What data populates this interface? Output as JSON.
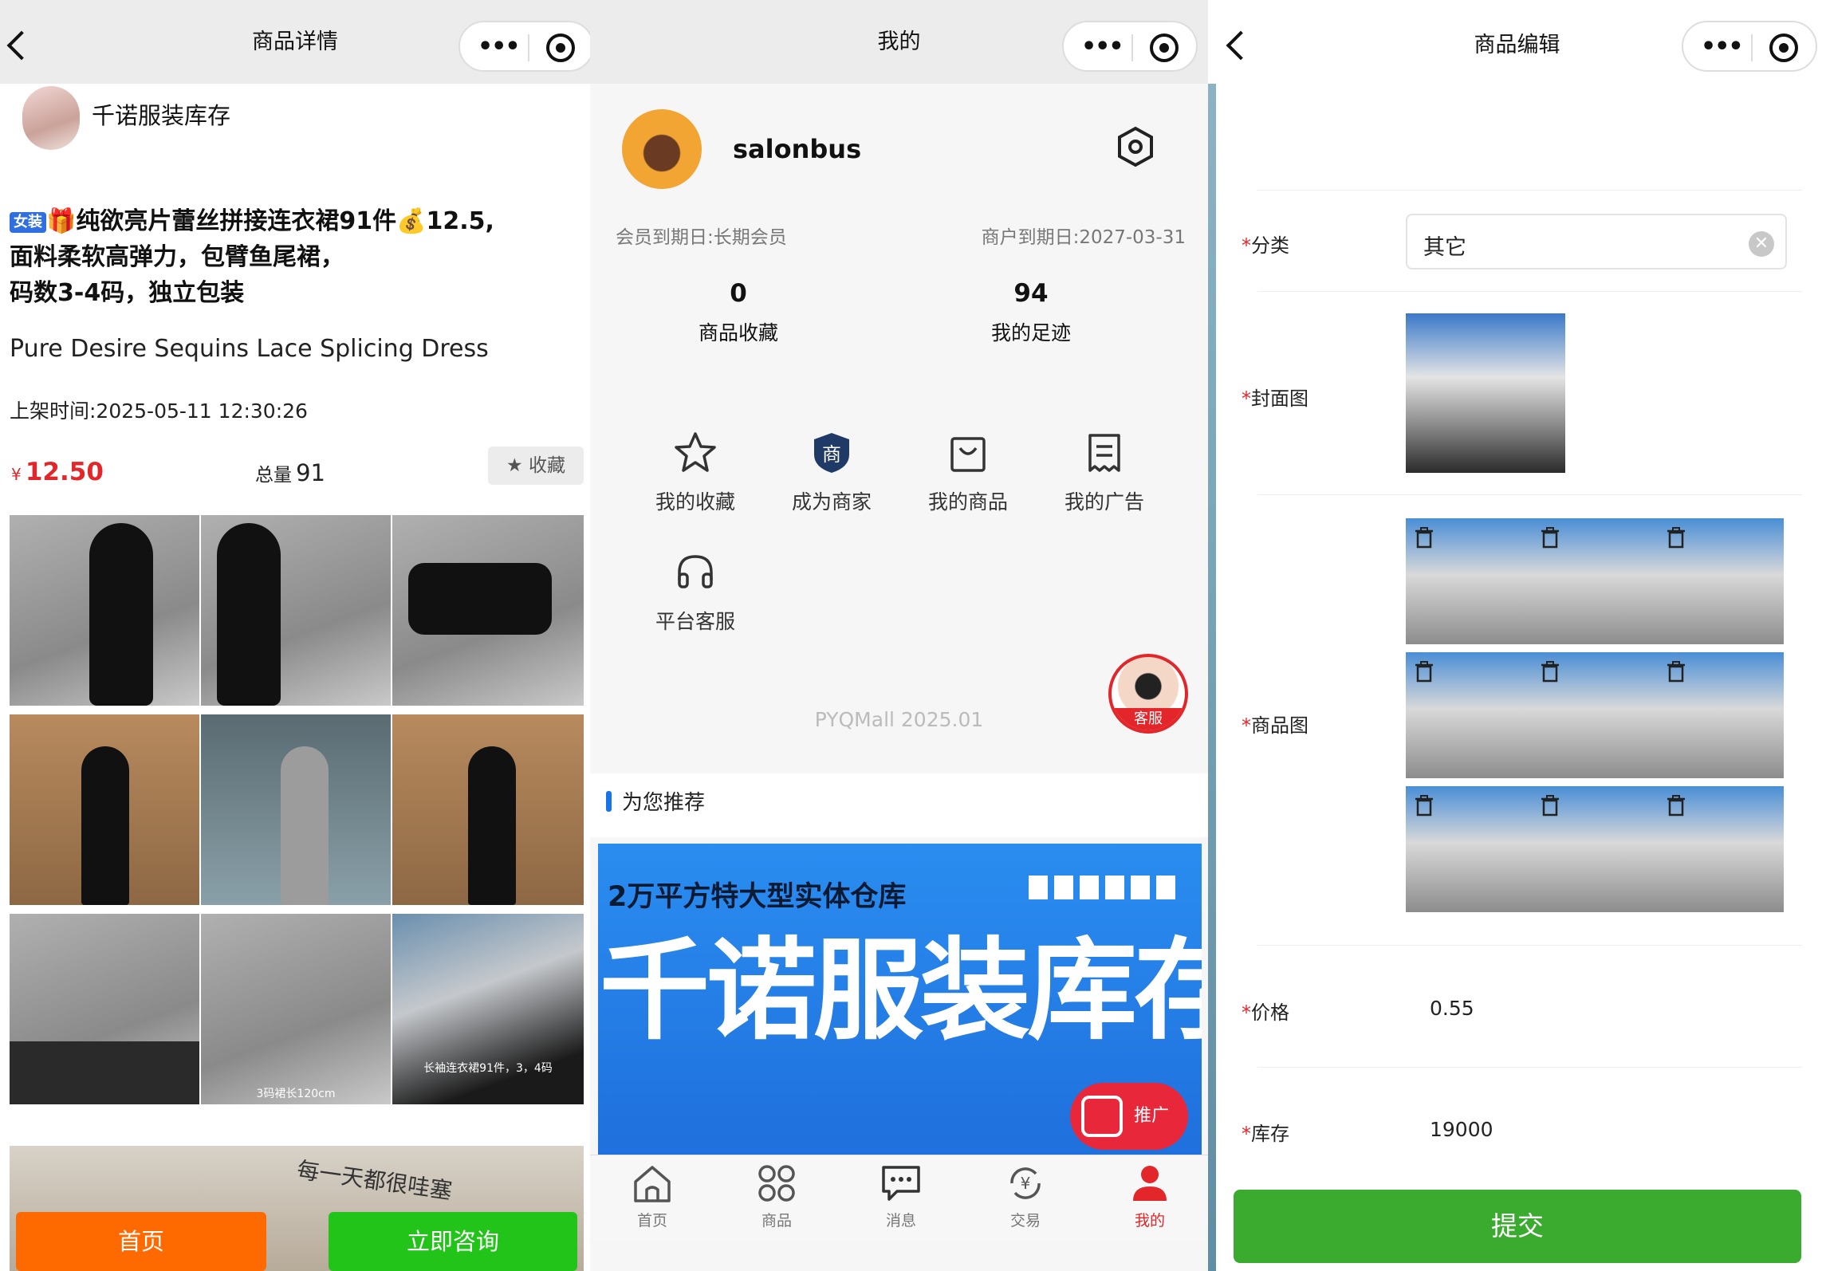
{
  "p1": {
    "nav_title": "商品详情",
    "shop_name": "千诺服装库存",
    "tag": "女装",
    "title_lines": [
      "🎁纯欲亮片蕾丝拼接连衣裙91件💰12.5,",
      "面料柔软高弹力，包臂鱼尾裙，",
      "码数3-4码，独立包装"
    ],
    "subtitle_en": "Pure Desire Sequins Lace Splicing Dress",
    "listed_time": "上架时间:2025-05-11 12:30:26",
    "price_symbol": "¥",
    "price": "12.50",
    "total_label": "总量",
    "total_value": "91",
    "fav_label": "收藏",
    "photo_caption_1": "3码裙长120cm",
    "photo_caption_2": "长袖连衣裙91件，3，4码",
    "banner_text": "每一天都很哇塞",
    "btn_home": "首页",
    "btn_consult": "立即咨询"
  },
  "p2": {
    "nav_title": "我的",
    "username": "salonbus",
    "member_expiry": "会员到期日:长期会员",
    "merchant_expiry": "商户到期日:2027-03-31",
    "stats": [
      {
        "value": "0",
        "label": "商品收藏"
      },
      {
        "value": "94",
        "label": "我的足迹"
      }
    ],
    "menu": [
      "我的收藏",
      "成为商家",
      "我的商品",
      "我的广告",
      "平台客服"
    ],
    "version": "PYQMall 2025.01",
    "service_label": "客服",
    "recommend_title": "为您推荐",
    "banner_sub": "2万平方特大型实体仓库",
    "banner_main": "千诺服装库存",
    "promo_label": "推广",
    "tabbar": [
      "首页",
      "商品",
      "消息",
      "交易",
      "我的"
    ],
    "accent": "#e3262a"
  },
  "p3": {
    "nav_title": "商品编辑",
    "fields": {
      "category_label": "分类",
      "category_value": "其它",
      "cover_label": "封面图",
      "images_label": "商品图",
      "price_label": "价格",
      "price_value": "0.55",
      "stock_label": "库存",
      "stock_value": "19000"
    },
    "required_mark": "*",
    "submit_label": "提交",
    "submit_color": "#3bab2f"
  }
}
